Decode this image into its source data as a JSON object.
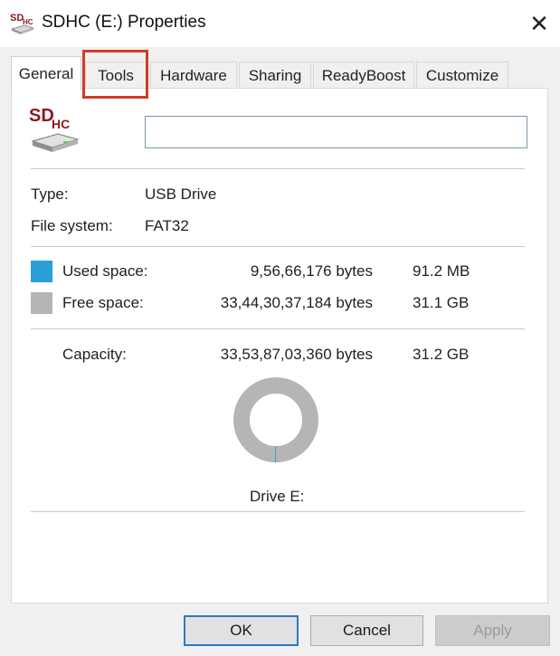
{
  "window": {
    "title": "SDHC (E:) Properties",
    "close_glyph": "✕",
    "icon": "sdhc-card-icon"
  },
  "tabs": [
    {
      "label": "General",
      "active": true
    },
    {
      "label": "Tools",
      "active": false,
      "highlighted": true
    },
    {
      "label": "Hardware",
      "active": false
    },
    {
      "label": "Sharing",
      "active": false
    },
    {
      "label": "ReadyBoost",
      "active": false
    },
    {
      "label": "Customize",
      "active": false
    }
  ],
  "general": {
    "drive_icon_text": {
      "top": "SD",
      "sub": "HC"
    },
    "volume_label_value": "",
    "type_label": "Type:",
    "type_value": "USB Drive",
    "filesystem_label": "File system:",
    "filesystem_value": "FAT32",
    "used": {
      "label": "Used space:",
      "bytes": "9,56,66,176 bytes",
      "size": "91.2 MB",
      "color": "#2a9fd8"
    },
    "free": {
      "label": "Free space:",
      "bytes": "33,44,30,37,184 bytes",
      "size": "31.1 GB",
      "color": "#b5b5b5"
    },
    "capacity": {
      "label": "Capacity:",
      "bytes": "33,53,87,03,360 bytes",
      "size": "31.2 GB"
    },
    "used_fraction": 0.0029,
    "drive_caption": "Drive E:"
  },
  "buttons": {
    "ok": "OK",
    "cancel": "Cancel",
    "apply": "Apply"
  },
  "colors": {
    "highlight_box": "#d13c2b",
    "default_button_border": "#2b79c6"
  }
}
